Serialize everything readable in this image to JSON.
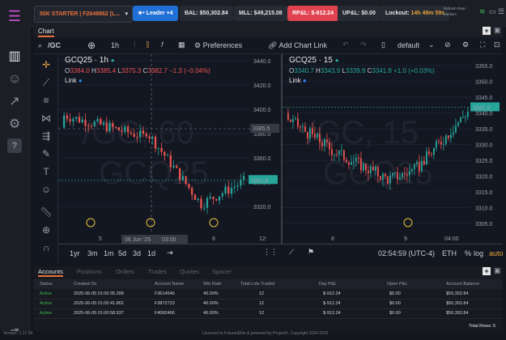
{
  "topbar": {
    "account_selector": "50K STARTER | F2649862 (L...",
    "leader_button": "★• Leader +4",
    "bal": "BAL: $50,302.84",
    "mll": "MLL: $49,215.08",
    "rpl": "RP&L: $-912.24",
    "upl": "UP&L: $0.00",
    "lockout_label": "Lockout:",
    "lockout_value": "14h 49m 59s",
    "refresh_label": "Refresh Rate:",
    "refresh_value": "Medium"
  },
  "chart_tab": "Chart",
  "toolbar": {
    "symbol": "/GC",
    "interval": "1h",
    "preferences": "Preferences",
    "add_chart_link": "Add Chart Link",
    "layout_name": "default"
  },
  "left_pane": {
    "title": "GCQ25 · 1h",
    "ohlc": {
      "o_label": "O",
      "o": "3384.0",
      "h_label": "H",
      "h": "3385.4",
      "l_label": "L",
      "l": "3375.3",
      "c_label": "C",
      "c": "3382.7",
      "chg": "−1.3 (−0.04%)"
    },
    "link_label": "Link",
    "watermark_line1": "/GC, 60",
    "watermark_line2": "GCQ25",
    "crosshair_price": "3385.5",
    "current_price": "3341.8",
    "price_ticks": [
      "3440.0",
      "3420.0",
      "3400.0",
      "3380.0",
      "3360.0",
      "3340.0",
      "3320.0"
    ],
    "time_ticks": [
      "5",
      "8",
      "12:"
    ],
    "crosshair_date": "06 Jun '25",
    "crosshair_time": "03:00"
  },
  "right_pane": {
    "title": "GCQ25 · 15",
    "ohlc": {
      "o_label": "O",
      "o": "3340.7",
      "h_label": "H",
      "h": "3343.9",
      "l_label": "L",
      "l": "3339.9",
      "c_label": "C",
      "c": "3341.8",
      "chg": "+1.0 (+0.03%)"
    },
    "link_label": "Link",
    "watermark_line1": "/GC, 15",
    "watermark_line2": "GCQ25",
    "current_price": "3341.8",
    "price_ticks": [
      "3355.0",
      "3350.0",
      "3345.0",
      "3340.0",
      "3335.0",
      "3330.0",
      "3325.0",
      "3320.0",
      "3315.0",
      "3310.0",
      "3305.0"
    ],
    "time_ticks": [
      "8",
      "9",
      "04:00"
    ]
  },
  "range_bar": {
    "ranges": [
      "1yr",
      "3m",
      "1m",
      "5d",
      "3d",
      "1d"
    ],
    "clock": "02:54:59 (UTC-4)",
    "session": "ETH",
    "pct": "%",
    "log": "log",
    "auto": "auto"
  },
  "bottom_tabs": [
    "Accounts",
    "Positions",
    "Orders",
    "Trades",
    "Quotes",
    "Spacer"
  ],
  "table": {
    "headers": [
      "Status",
      "Created On",
      "Account Name",
      "Win Rate",
      "Total Lots Traded",
      "Day P&L",
      "Open P&L",
      "Account Balance"
    ],
    "rows": [
      [
        "Active",
        "2025-06-05 01:00:35.398",
        "F3614546",
        "40.00%",
        "12",
        "$-912.24",
        "$0.00",
        "$50,302.84"
      ],
      [
        "Active",
        "2025-06-05 01:00:41.862",
        "F3872723",
        "40.00%",
        "12",
        "$-912.24",
        "$0.00",
        "$50,302.84"
      ],
      [
        "Active",
        "2025-06-05 01:00:58.537",
        "F4092466",
        "40.00%",
        "12",
        "$-912.24",
        "$0.00",
        "$50,302.84"
      ]
    ],
    "total_rows": "Total Rows: 5"
  },
  "footer": {
    "version": "Version: 1.17.34",
    "license": "Licensed to FuturesElite & powered by ProjectX. Copyright 2024-2025"
  },
  "colors": {
    "up": "#26a69a",
    "down": "#ef5350",
    "accent": "#e8703a",
    "green_pill": "#1f6f4a"
  }
}
